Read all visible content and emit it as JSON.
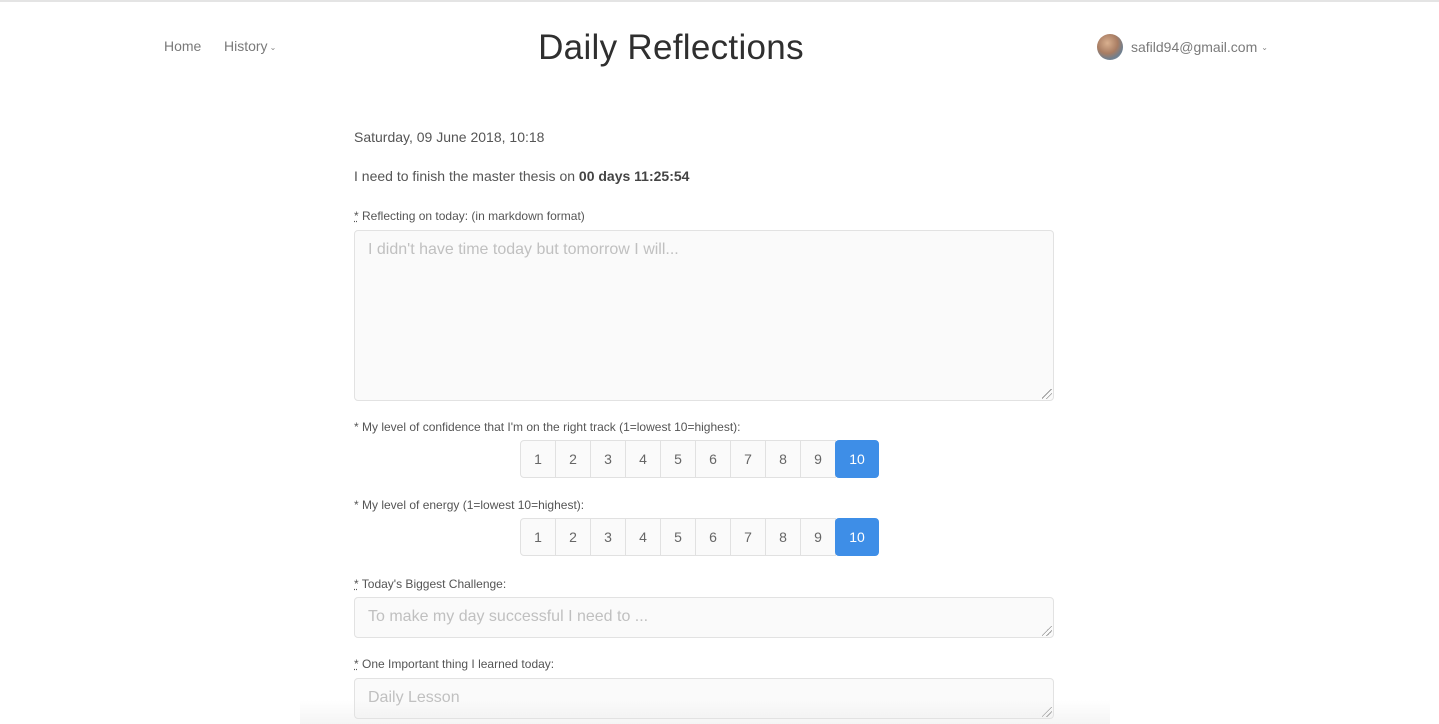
{
  "nav": {
    "home_label": "Home",
    "history_label": "History",
    "caret_glyph": "⌄"
  },
  "header": {
    "title": "Daily Reflections"
  },
  "user": {
    "email": "safild94@gmail.com",
    "caret_glyph": "⌄"
  },
  "main": {
    "date": "Saturday, 09 June 2018, 10:18",
    "countdown_prefix": "I need to finish the master thesis on ",
    "countdown_value": "00 days 11:25:54",
    "reflection": {
      "required_mark": "*",
      "label": " Reflecting on today: (in markdown format)",
      "placeholder": "I didn't have time today but tomorrow I will...",
      "value": ""
    },
    "confidence": {
      "label": "* My level of confidence that I'm on the right track (1=lowest 10=highest):",
      "options": [
        "1",
        "2",
        "3",
        "4",
        "5",
        "6",
        "7",
        "8",
        "9",
        "10"
      ],
      "selected": "10"
    },
    "energy": {
      "label": "* My level of energy (1=lowest 10=highest):",
      "options": [
        "1",
        "2",
        "3",
        "4",
        "5",
        "6",
        "7",
        "8",
        "9",
        "10"
      ],
      "selected": "10"
    },
    "challenge": {
      "required_mark": "*",
      "label": " Today's Biggest Challenge:",
      "placeholder": "To make my day successful I need to ...",
      "value": ""
    },
    "lesson": {
      "required_mark": "*",
      "label": " One Important thing I learned today:",
      "placeholder": "Daily Lesson",
      "value": ""
    }
  },
  "colors": {
    "accent": "#3e8ee7",
    "title": "#2f2f2f",
    "text": "#555555"
  }
}
